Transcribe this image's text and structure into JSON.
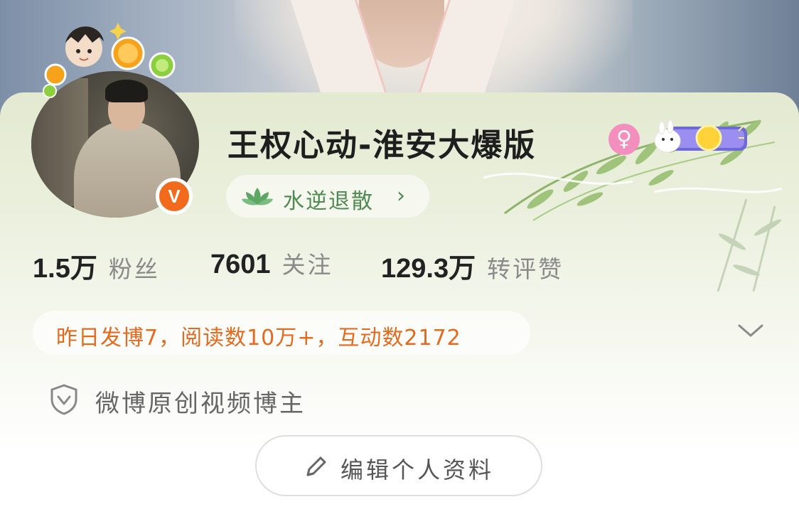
{
  "profile": {
    "username": "王权心动-淮安大爆版",
    "gender_symbol": "♀",
    "verified_badge": "V",
    "tag": {
      "label": "水逆退散",
      "chevron": "›"
    },
    "stats": [
      {
        "value": "1.5万",
        "label": "粉丝"
      },
      {
        "value": "7601",
        "label": "关注"
      },
      {
        "value": "129.3万",
        "label": "转评赞"
      }
    ],
    "yesterday_summary": "昨日发博7，阅读数10万+，互动数2172",
    "verification": "微博原创视频博主",
    "edit_button": "编辑个人资料"
  },
  "icons": {
    "gender": "female-icon",
    "tag": "lotus-icon",
    "expand": "chevron-down-icon",
    "verification": "shield-check-icon",
    "edit": "pencil-icon"
  },
  "colors": {
    "accent_orange": "#e56a1e",
    "vip_badge": "#f26b1d",
    "tag_green": "#4f8a52",
    "gender_pink": "#f38fbf"
  }
}
